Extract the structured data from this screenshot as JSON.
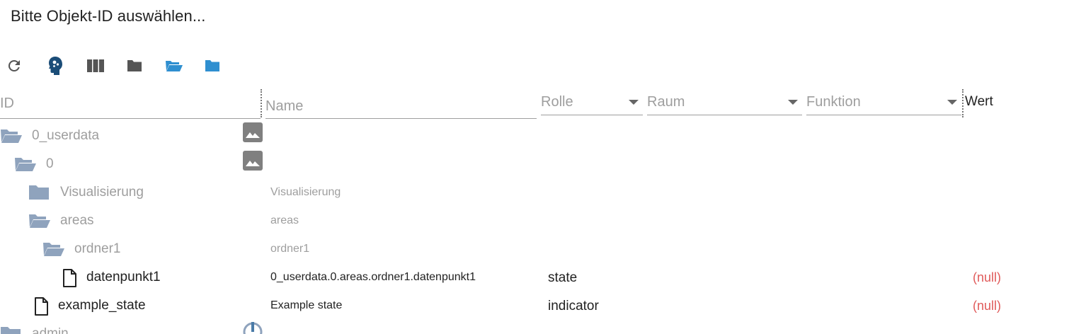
{
  "dialog": {
    "title": "Bitte Objekt-ID auswählen..."
  },
  "toolbar": {
    "buttons": [
      {
        "name": "refresh",
        "icon": "refresh-icon"
      },
      {
        "name": "expert-mode",
        "icon": "brain-head-icon"
      },
      {
        "name": "columns",
        "icon": "columns-icon"
      },
      {
        "name": "collapse-all",
        "icon": "folder-closed-icon"
      },
      {
        "name": "expand-all",
        "icon": "folder-open-icon"
      },
      {
        "name": "expand-one",
        "icon": "folder-icon"
      }
    ]
  },
  "filters": {
    "id_placeholder": "ID",
    "name_placeholder": "Name",
    "role_label": "Rolle",
    "room_label": "Raum",
    "function_label": "Funktion",
    "value_header": "Wert"
  },
  "colors": {
    "folder": "#8fa3bd",
    "accent": "#2f8fd0",
    "null_value": "#e05a5a",
    "dark_icon": "#1b4d78"
  },
  "rows": [
    {
      "id": "0_userdata",
      "name": "",
      "role": "",
      "value": "",
      "type": "folder-open",
      "level": 0,
      "has_image": true
    },
    {
      "id": "0",
      "name": "",
      "role": "",
      "value": "",
      "type": "folder-open",
      "level": 1,
      "has_image": true
    },
    {
      "id": "Visualisierung",
      "name": "Visualisierung",
      "role": "",
      "value": "",
      "type": "folder-closed",
      "level": 2,
      "has_image": false
    },
    {
      "id": "areas",
      "name": "areas",
      "role": "",
      "value": "",
      "type": "folder-open",
      "level": 2,
      "has_image": false
    },
    {
      "id": "ordner1",
      "name": "ordner1",
      "role": "",
      "value": "",
      "type": "folder-open",
      "level": 3,
      "has_image": false
    },
    {
      "id": "datenpunkt1",
      "name": "0_userdata.0.areas.ordner1.datenpunkt1",
      "role": "state",
      "value": "(null)",
      "type": "file",
      "level": 4,
      "has_image": false
    },
    {
      "id": "example_state",
      "name": "Example state",
      "role": "indicator",
      "value": "(null)",
      "type": "file",
      "level": 2,
      "has_image": false
    },
    {
      "id": "admin",
      "name": "",
      "role": "",
      "value": "",
      "type": "folder-closed",
      "level": 0,
      "has_image": false,
      "has_power": true
    }
  ]
}
